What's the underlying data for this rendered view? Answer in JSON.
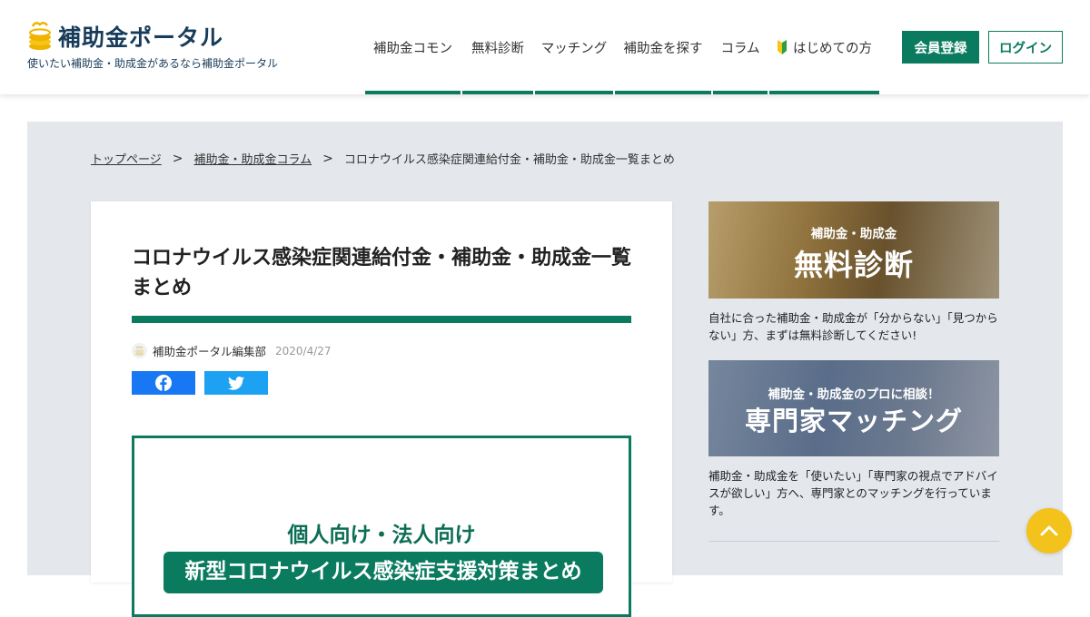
{
  "header": {
    "logo_text": "補助金ポータル",
    "tagline": "使いたい補助金・助成金があるなら補助金ポータル",
    "nav": [
      {
        "label": "補助金コモン"
      },
      {
        "label": "無料診断"
      },
      {
        "label": "マッチング"
      },
      {
        "label": "補助金を探す"
      },
      {
        "label": "コラム"
      },
      {
        "label": "はじめての方",
        "icon": "beginner-mark-icon"
      }
    ],
    "register_label": "会員登録",
    "login_label": "ログイン"
  },
  "breadcrumb": {
    "home": "トップページ",
    "sep": ">",
    "category": "補助金・助成金コラム",
    "current": "コロナウイルス感染症関連給付金・補助金・助成金一覧まとめ"
  },
  "article": {
    "title": "コロナウイルス感染症関連給付金・補助金・助成金一覧まとめ",
    "author": "補助金ポータル編集部",
    "date": "2020/4/27",
    "hero_sub": "個人向け・法人向け",
    "hero_banner": "新型コロナウイルス感染症支援対策まとめ"
  },
  "sidebar": {
    "diagnosis": {
      "small": "補助金・助成金",
      "big": "無料診断",
      "desc": "自社に合った補助金・助成金が「分からない」「見つからない」方、まずは無料診断してください!"
    },
    "matching": {
      "small": "補助金・助成金のプロに相談！",
      "big": "専門家マッチング",
      "desc": "補助金・助成金を「使いたい」「専門家の視点でアドバイスが欲しい」方へ、専門家とのマッチングを行っています。"
    }
  },
  "colors": {
    "brand_green": "#0b7b5f",
    "navy": "#173c5a",
    "scroll_top": "#f3c21b"
  }
}
